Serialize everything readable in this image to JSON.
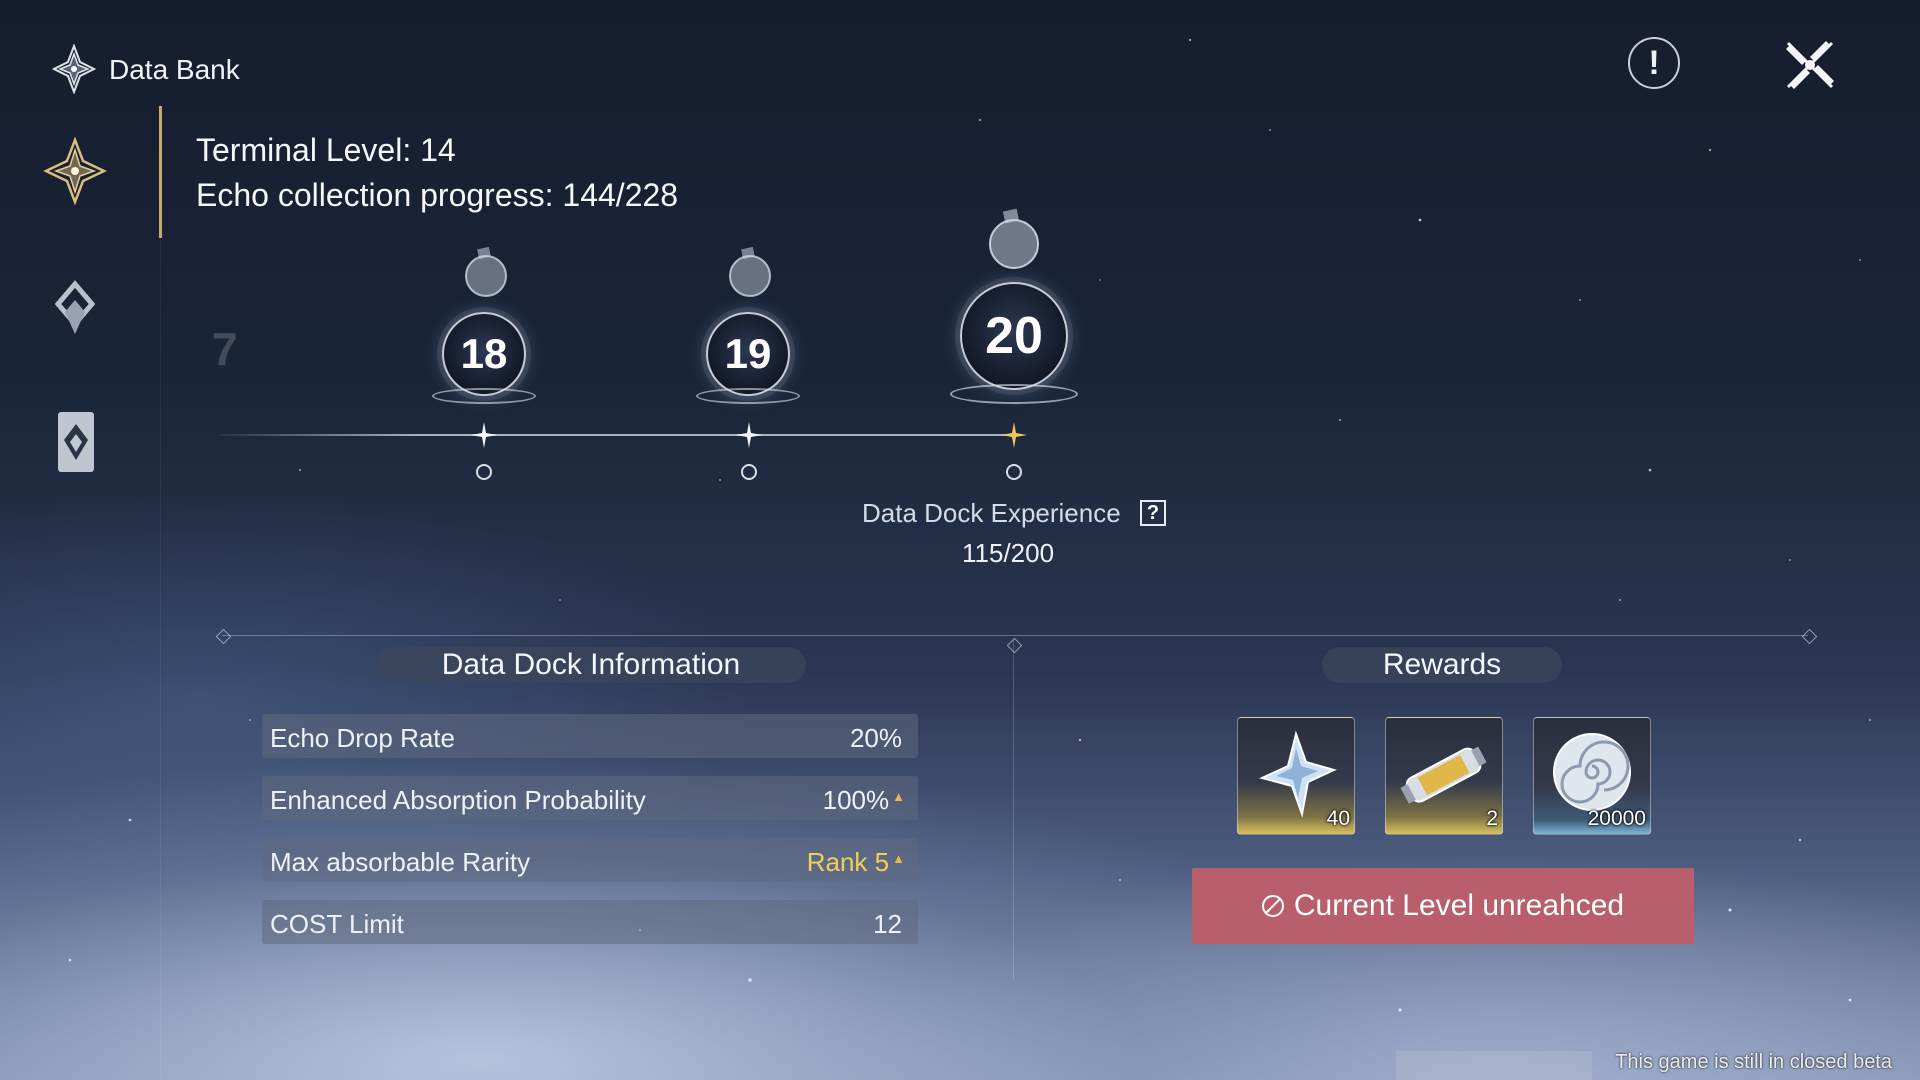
{
  "header": {
    "title": "Data Bank",
    "title_icon": "data-bank-emblem-icon",
    "alert_label": "!",
    "close_icon": "close-x-icon"
  },
  "sidebar": {
    "items": [
      {
        "icon": "data-dock-emblem-icon",
        "active": true
      },
      {
        "icon": "echo-diamond-icon",
        "active": false
      },
      {
        "icon": "echo-card-icon",
        "active": false
      }
    ]
  },
  "terminal": {
    "level_text": "Terminal Level: 14",
    "progress_text": "Echo collection progress: 144/228"
  },
  "levels": {
    "ghost": "7",
    "items": [
      "18",
      "19",
      "20"
    ]
  },
  "experience": {
    "label": "Data Dock Experience",
    "help_label": "?",
    "value": "115/200",
    "current": 115,
    "max": 200
  },
  "dock_info": {
    "title": "Data Dock Information",
    "rows": [
      {
        "label": "Echo Drop Rate",
        "value": "20%"
      },
      {
        "label": "Enhanced Absorption Probability",
        "value": "100%"
      },
      {
        "label": "Max absorbable Rarity",
        "value": "Rank 5"
      },
      {
        "label": "COST Limit",
        "value": "12"
      }
    ]
  },
  "rewards": {
    "title": "Rewards",
    "items": [
      {
        "icon": "crystal-shard-icon",
        "quantity": "40",
        "rarity_color": "#d7c15e"
      },
      {
        "icon": "energy-core-icon",
        "quantity": "2",
        "rarity_color": "#d7c15e"
      },
      {
        "icon": "shell-credit-icon",
        "quantity": "20000",
        "rarity_color": "#7eb4d8"
      }
    ],
    "status_button": "Current Level unreahced",
    "status_color": "#b85f6b"
  },
  "footer": {
    "beta_notice": "This game is still in closed beta"
  }
}
